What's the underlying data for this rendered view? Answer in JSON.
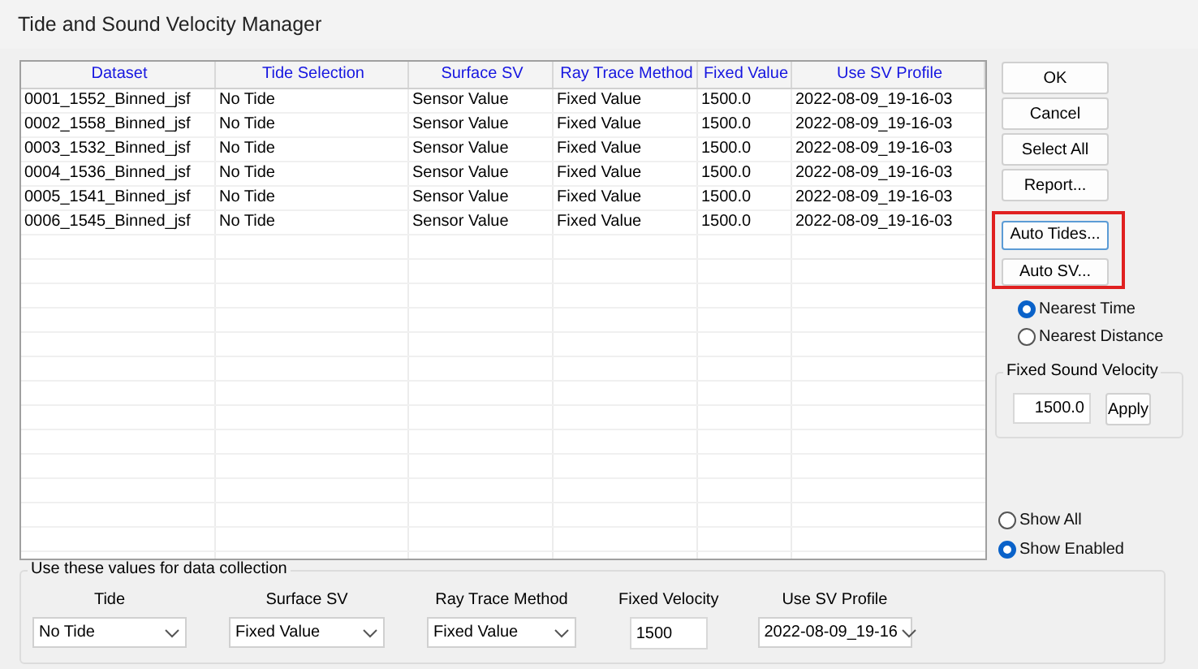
{
  "window": {
    "title": "Tide and Sound Velocity Manager"
  },
  "table": {
    "columns": [
      "Dataset",
      "Tide Selection",
      "Surface SV",
      "Ray Trace Method",
      "Fixed Value",
      "Use SV Profile"
    ],
    "rows": [
      {
        "cells": [
          "0001_1552_Binned_jsf",
          "No Tide",
          "Sensor Value",
          "Fixed Value",
          "1500.0",
          "2022-08-09_19-16-03"
        ]
      },
      {
        "cells": [
          "0002_1558_Binned_jsf",
          "No Tide",
          "Sensor Value",
          "Fixed Value",
          "1500.0",
          "2022-08-09_19-16-03"
        ]
      },
      {
        "cells": [
          "0003_1532_Binned_jsf",
          "No Tide",
          "Sensor Value",
          "Fixed Value",
          "1500.0",
          "2022-08-09_19-16-03"
        ]
      },
      {
        "cells": [
          "0004_1536_Binned_jsf",
          "No Tide",
          "Sensor Value",
          "Fixed Value",
          "1500.0",
          "2022-08-09_19-16-03"
        ]
      },
      {
        "cells": [
          "0005_1541_Binned_jsf",
          "No Tide",
          "Sensor Value",
          "Fixed Value",
          "1500.0",
          "2022-08-09_19-16-03"
        ]
      },
      {
        "cells": [
          "0006_1545_Binned_jsf",
          "No Tide",
          "Sensor Value",
          "Fixed Value",
          "1500.0",
          "2022-08-09_19-16-03"
        ]
      }
    ]
  },
  "buttons": [
    {
      "label": "OK",
      "focused": false
    },
    {
      "label": "Cancel",
      "focused": false
    },
    {
      "label": "Select All",
      "focused": false
    },
    {
      "label": "Report...",
      "focused": false
    }
  ],
  "auto_buttons": [
    {
      "label": "Auto Tides...",
      "focused": true
    },
    {
      "label": "Auto SV...",
      "focused": false
    }
  ],
  "nearest_options": [
    {
      "label": "Nearest Time",
      "selected": true
    },
    {
      "label": "Nearest Distance",
      "selected": false
    }
  ],
  "fixed_sound_velocity": {
    "title": "Fixed Sound Velocity",
    "value": "1500.0",
    "button": "Apply"
  },
  "show_options": [
    {
      "label": "Show All",
      "selected": false
    },
    {
      "label": "Show Enabled",
      "selected": true
    }
  ],
  "collection": {
    "title": "Use these values for data collection",
    "fields": [
      {
        "label": "Tide",
        "kind": "combo",
        "value": "No Tide"
      },
      {
        "label": "Surface SV",
        "kind": "combo",
        "value": "Fixed Value"
      },
      {
        "label": "Ray Trace Method",
        "kind": "combo",
        "value": "Fixed Value"
      },
      {
        "label": "Fixed Velocity",
        "kind": "text",
        "value": "1500"
      },
      {
        "label": "Use SV Profile",
        "kind": "combo",
        "value": "2022-08-09_19-16"
      }
    ]
  }
}
